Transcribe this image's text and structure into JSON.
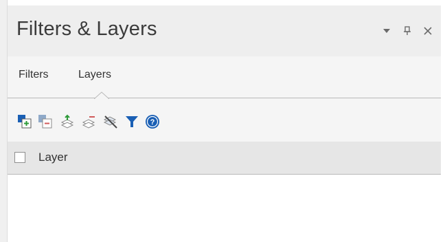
{
  "window": {
    "title": "Filters & Layers",
    "controls": [
      {
        "name": "dropdown-icon"
      },
      {
        "name": "pin-icon"
      },
      {
        "name": "close-icon"
      }
    ]
  },
  "tabs": [
    {
      "label": "Filters",
      "active": false
    },
    {
      "label": "Layers",
      "active": true
    }
  ],
  "toolbar": {
    "icons": [
      "add-layer-icon",
      "remove-layer-icon",
      "layer-up-icon",
      "layer-down-icon",
      "clear-layers-icon",
      "filter-icon",
      "help-icon"
    ]
  },
  "list": {
    "column_label": "Layer",
    "select_all_checked": false,
    "rows": []
  },
  "colors": {
    "title_bg": "#eeeeee",
    "tabs_bg": "#f5f5f5",
    "header_bg": "#e6e6e6",
    "icon_blue": "#1a5fb4",
    "icon_green": "#2f9b3a"
  }
}
